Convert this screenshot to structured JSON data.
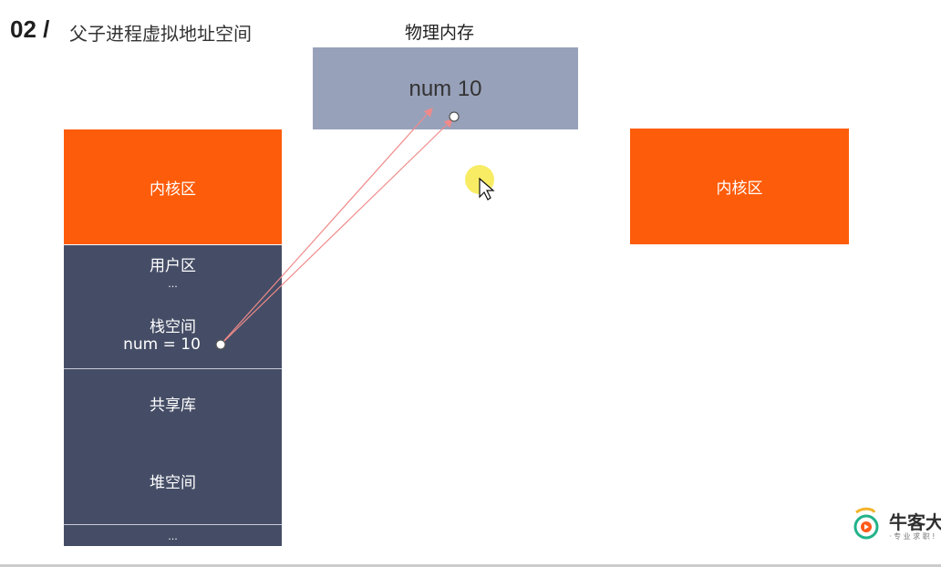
{
  "title": {
    "number": "02 /",
    "subtitle": "父子进程虚拟地址空间"
  },
  "physical_memory": {
    "label": "物理内存",
    "value": "num 10"
  },
  "process_left": {
    "kernel": "内核区",
    "user": "用户区",
    "ellipsis_top": "...",
    "stack": "栈空间",
    "stack_var": "num = 10",
    "shared_lib": "共享库",
    "heap": "堆空间",
    "ellipsis_bottom": "..."
  },
  "process_right": {
    "kernel": "内核区"
  },
  "logo": {
    "text": "牛客大",
    "tagline": "· 专 业 求 职 !"
  },
  "colors": {
    "kernel": "#fd5c0a",
    "user_space": "#454d66",
    "physical": "#98a1ba",
    "arrow": "#f08a8a",
    "cursor_highlight": "#f7e94a"
  }
}
